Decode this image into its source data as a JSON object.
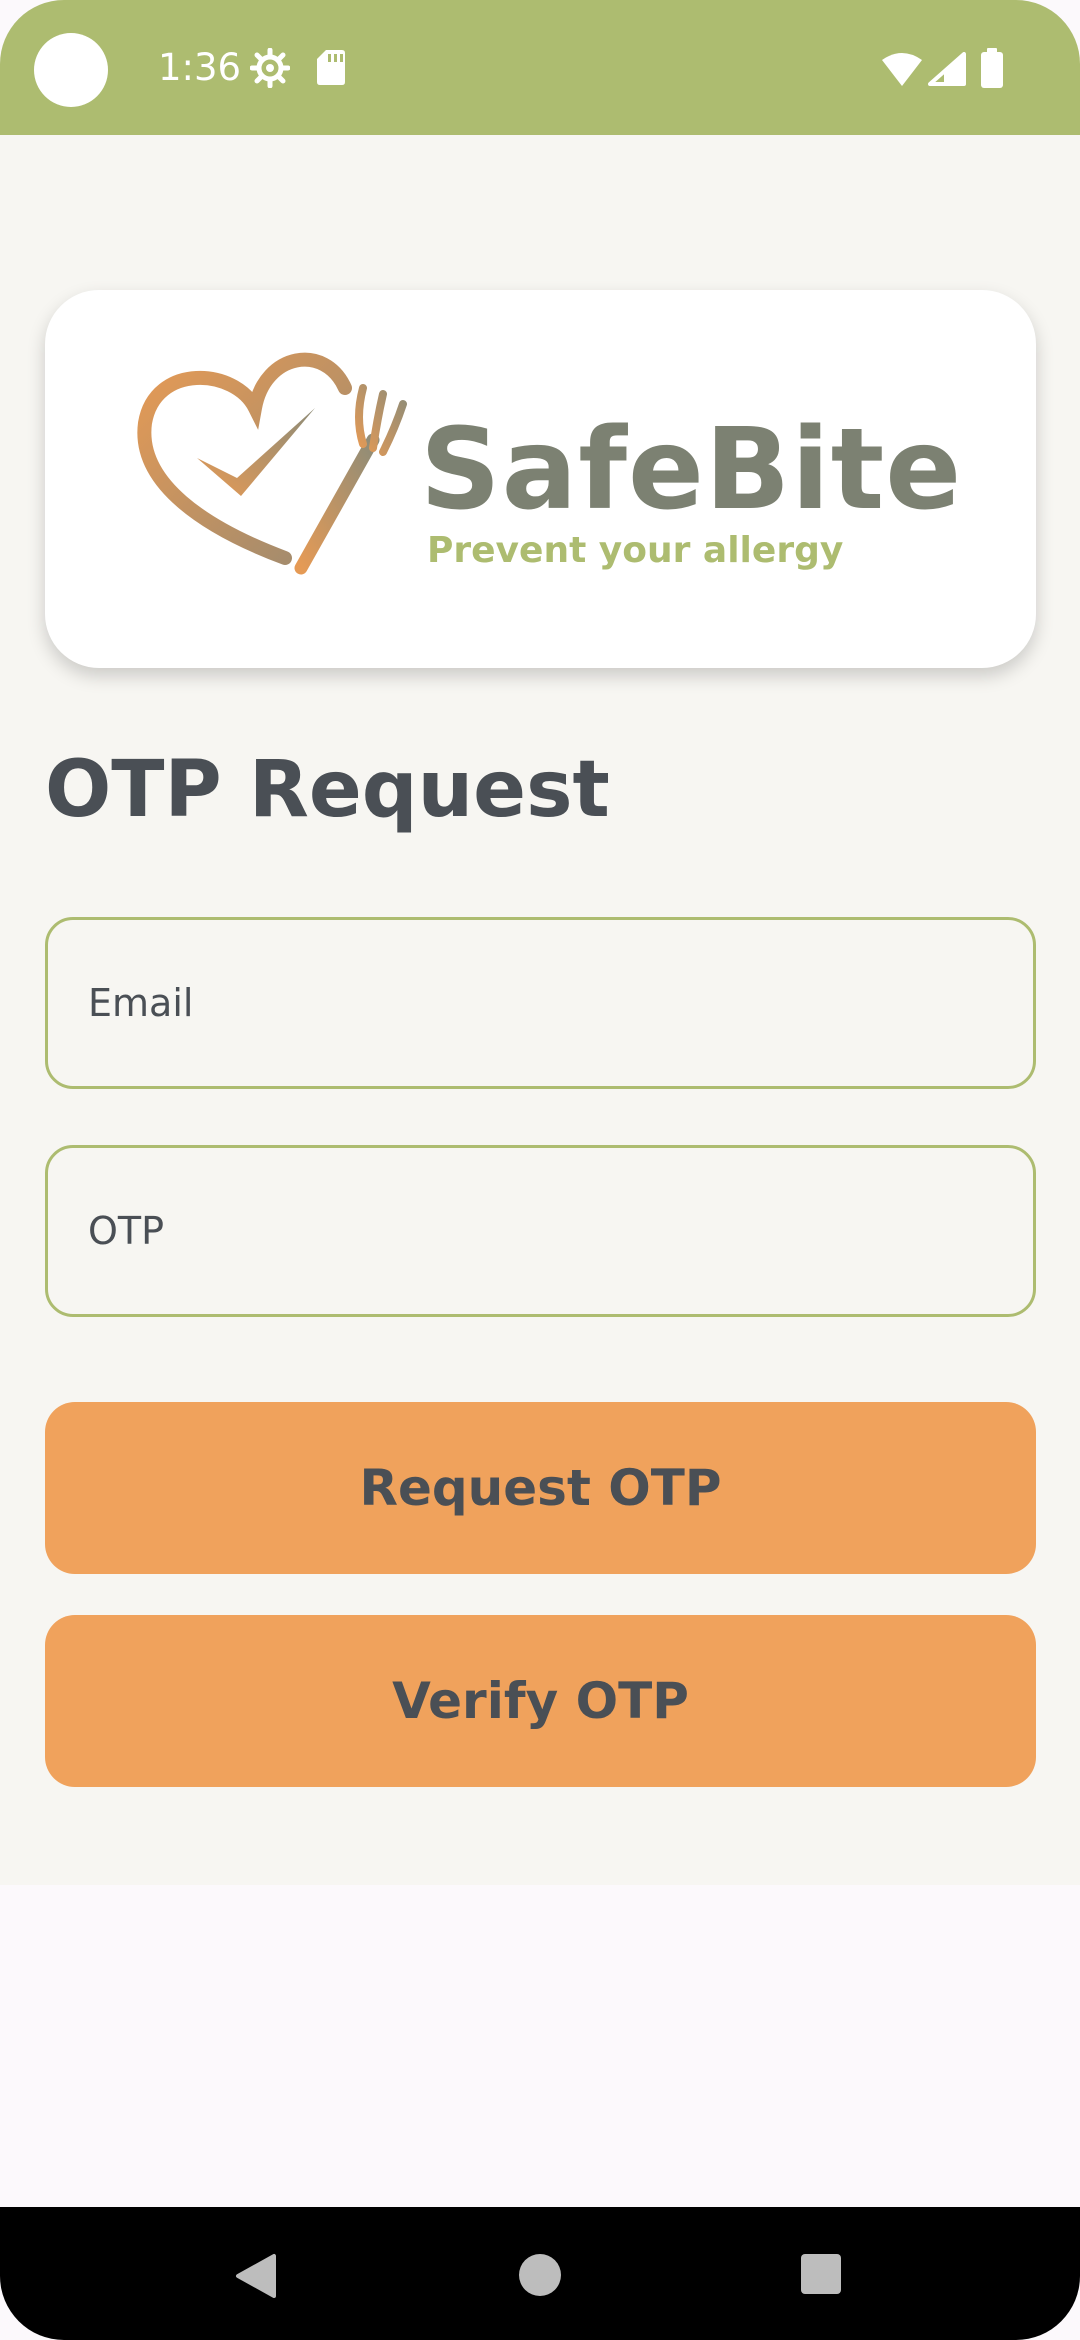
{
  "status_bar": {
    "time": "1:36",
    "icons": [
      "gear-icon",
      "sd-card-icon",
      "wifi-icon",
      "signal-icon",
      "battery-icon"
    ]
  },
  "logo": {
    "brand_name": "SafeBite",
    "tagline": "Prevent your allergy"
  },
  "page": {
    "title": "OTP Request"
  },
  "form": {
    "email_placeholder": "Email",
    "otp_placeholder": "OTP",
    "request_button_label": "Request OTP",
    "verify_button_label": "Verify OTP"
  },
  "nav_bar": {
    "icons": [
      "back-icon",
      "home-icon",
      "recents-icon"
    ]
  },
  "colors": {
    "status_bar": "#ADBC70",
    "accent_green": "#ADBC70",
    "button_orange": "#F0A25C",
    "text_dark": "#4A4F55",
    "brand_gray": "#7C8172",
    "background": "#F7F6F2"
  }
}
